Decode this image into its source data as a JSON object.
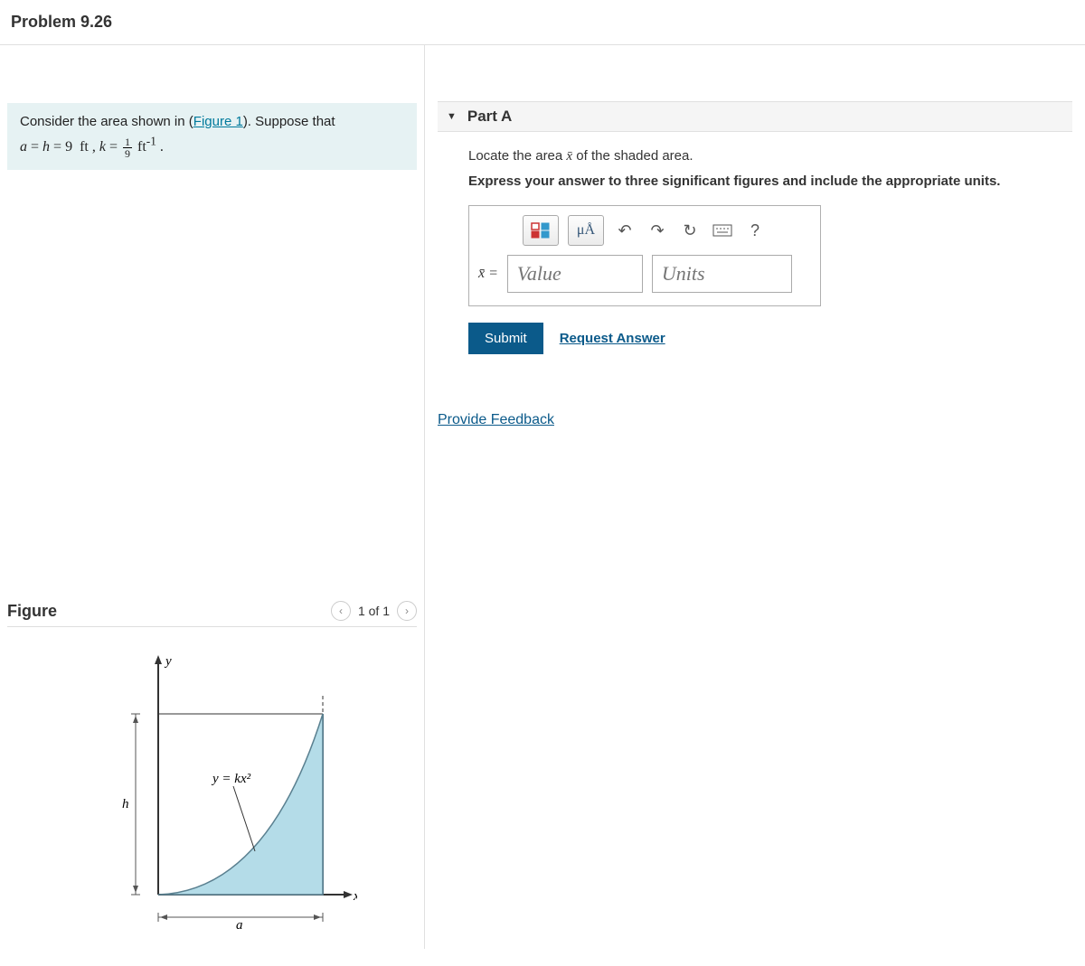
{
  "problem": {
    "title": "Problem 9.26",
    "infobox_pre": "Consider the area shown in (",
    "figure_link": "Figure 1",
    "infobox_post": "). Suppose that ",
    "given_a": "a",
    "given_h": "h",
    "given_val": "9",
    "given_unit": "ft",
    "given_k": "k",
    "k_num": "1",
    "k_den": "9",
    "k_unit": "ft",
    "k_exp": "-1"
  },
  "figure": {
    "title": "Figure",
    "counter": "1 of 1",
    "curve_label": "y = kx²",
    "h_label": "h",
    "a_label": "a",
    "x_label": "x",
    "y_label": "y"
  },
  "part": {
    "label": "Part A",
    "prompt_pre": "Locate the area ",
    "prompt_var": "x̄",
    "prompt_post": " of the shaded area.",
    "instructions": "Express your answer to three significant figures and include the appropriate units.",
    "xbar_eq": "x̄ =",
    "value_placeholder": "Value",
    "units_placeholder": "Units",
    "submit_label": "Submit",
    "request_label": "Request Answer",
    "units_btn": "μÅ",
    "help_btn": "?"
  },
  "feedback": "Provide Feedback"
}
